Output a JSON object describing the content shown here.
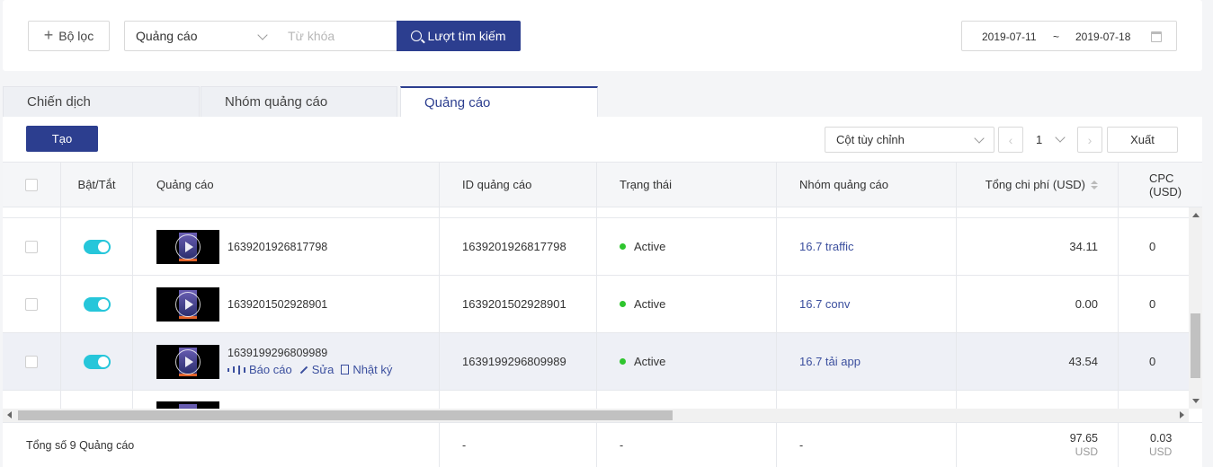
{
  "filter": {
    "filter_button_label": "Bộ lọc",
    "type_select_value": "Quảng cáo",
    "keyword_placeholder": "Từ khóa",
    "search_button_label": "Lượt tìm kiếm",
    "date_start": "2019-07-11",
    "date_separator": "~",
    "date_end": "2019-07-18"
  },
  "tabs": [
    {
      "label": "Chiến dịch",
      "active": false
    },
    {
      "label": "Nhóm quảng cáo",
      "active": false
    },
    {
      "label": "Quảng cáo",
      "active": true
    }
  ],
  "toolbar": {
    "create_label": "Tạo",
    "columns_select_value": "Cột tùy chỉnh",
    "page_value": "1",
    "export_label": "Xuất"
  },
  "table": {
    "headers": [
      "Bật/Tắt",
      "Quảng cáo",
      "ID quảng cáo",
      "Trạng thái",
      "Nhóm quảng cáo",
      "Tổng chi phí (USD)",
      "CPC (USD)"
    ],
    "rows": [
      {
        "ad_name": "1639201926817798",
        "ad_id": "1639201926817798",
        "status": "Active",
        "ad_group": "16.7 traffic",
        "cost": "34.11",
        "cpc": "0",
        "enabled": true
      },
      {
        "ad_name": "1639201502928901",
        "ad_id": "1639201502928901",
        "status": "Active",
        "ad_group": "16.7 conv",
        "cost": "0.00",
        "cpc": "0",
        "enabled": true
      },
      {
        "ad_name": "1639199296809989",
        "ad_id": "1639199296809989",
        "status": "Active",
        "ad_group": "16.7 tải app",
        "cost": "43.54",
        "cpc": "0",
        "enabled": true,
        "selected": true,
        "actions": [
          "Báo cáo",
          "Sửa",
          "Nhật ký"
        ]
      }
    ],
    "footer": {
      "total_label": "Tổng số 9 Quảng cáo",
      "id_dash": "-",
      "status_dash": "-",
      "group_dash": "-",
      "cost_total": "97.65",
      "cost_unit": "USD",
      "cpc_total": "0.03",
      "cpc_unit": "USD"
    }
  },
  "colors": {
    "primary": "#2c3e8f",
    "toggle_on": "#26c6da",
    "status_active": "#2ec52e",
    "link": "#3b4f9e"
  }
}
